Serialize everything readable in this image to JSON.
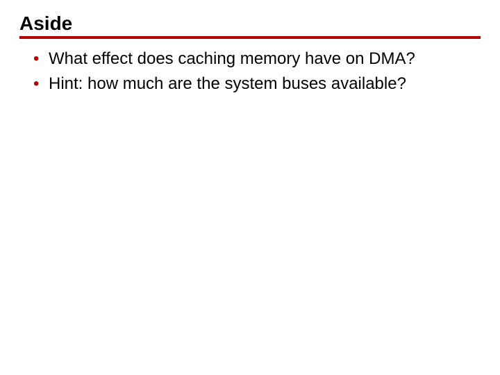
{
  "accent_color": "#b40000",
  "title": "Aside",
  "bullets": [
    "What effect does caching memory have on DMA?",
    "Hint:  how much are the system buses available?"
  ]
}
